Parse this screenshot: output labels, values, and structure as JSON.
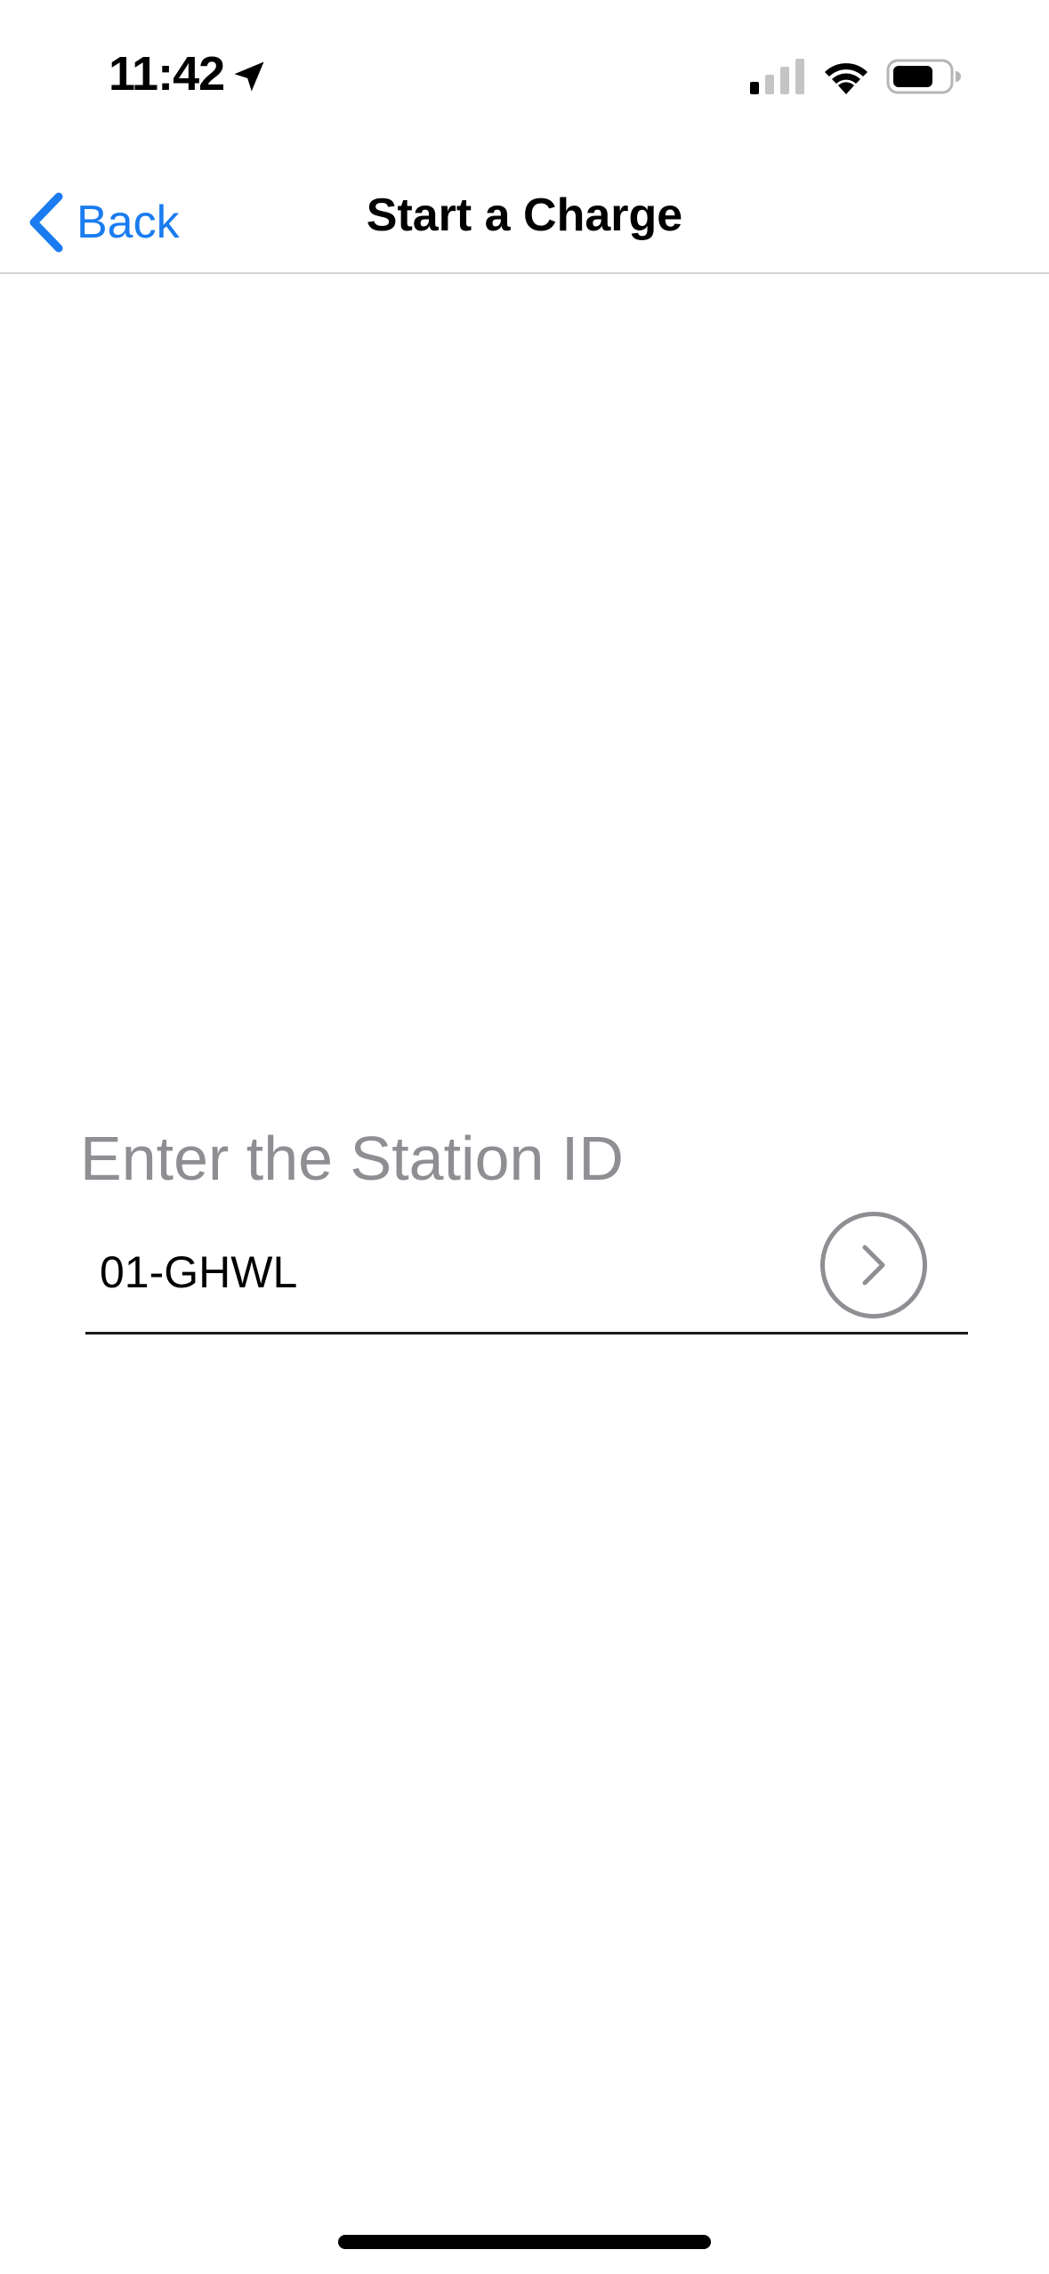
{
  "status_bar": {
    "time": "11:42",
    "icons": {
      "location": "location-arrow-icon",
      "signal": "cellular-signal-icon",
      "wifi": "wifi-icon",
      "battery": "battery-icon"
    }
  },
  "nav": {
    "back_label": "Back",
    "title": "Start a Charge",
    "back_icon": "chevron-left-icon"
  },
  "form": {
    "label": "Enter the Station ID",
    "station_id_value": "01-GHWL",
    "submit_icon": "chevron-right-icon"
  },
  "colors": {
    "accent": "#1a7cf0",
    "label_gray": "#8e8e93",
    "divider": "#d6d6d8",
    "text": "#000000"
  }
}
